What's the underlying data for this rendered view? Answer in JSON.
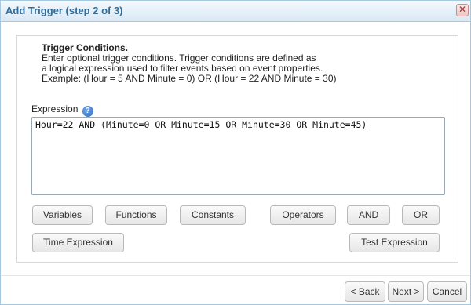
{
  "dialog": {
    "title": "Add Trigger (step 2 of 3)",
    "close_label": "✕"
  },
  "instructions": {
    "heading": "Trigger Conditions.",
    "line1": "Enter optional trigger conditions. Trigger conditions are defined as",
    "line2": "a logical expression used to filter events based on event properties.",
    "line3": "Example: (Hour = 5 AND Minute = 0) OR (Hour = 22 AND Minute = 30)"
  },
  "expression": {
    "label": "Expression",
    "help_icon": "?",
    "value": "Hour=22 AND (Minute=0 OR Minute=15 OR Minute=30 OR Minute=45)"
  },
  "builder_buttons": {
    "variables": "Variables",
    "functions": "Functions",
    "constants": "Constants",
    "operators": "Operators",
    "and": "AND",
    "or": "OR",
    "time_expression": "Time Expression",
    "test_expression": "Test Expression"
  },
  "footer": {
    "back": "< Back",
    "next": "Next >",
    "cancel": "Cancel"
  }
}
